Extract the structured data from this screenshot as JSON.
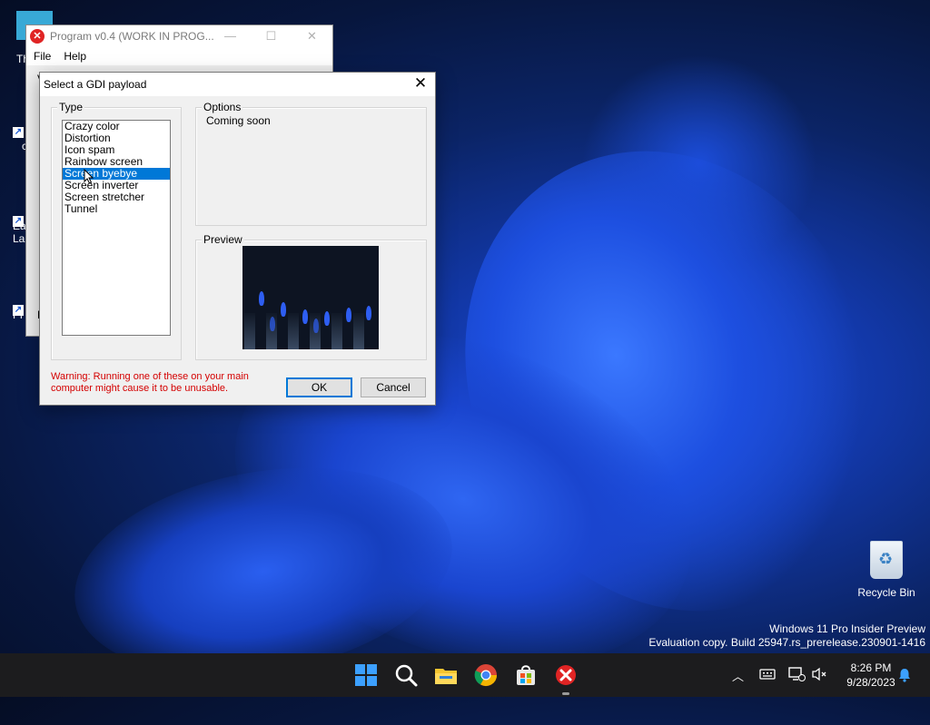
{
  "desktop": {
    "partial_labels": [
      "Th",
      "c",
      "Ea",
      "La",
      "Pr"
    ],
    "recycle_bin_label": "Recycle Bin",
    "watermark": {
      "line1": "Windows 11 Pro Insider Preview",
      "line2": "Evaluation copy. Build 25947.rs_prerelease.230901-1416"
    }
  },
  "background_window": {
    "title": "Program v0.4 (WORK IN PROG...",
    "menu": [
      "File",
      "Help"
    ],
    "peek_letters": [
      "V",
      "E"
    ]
  },
  "dialog": {
    "title": "Select a GDI payload",
    "type_group_label": "Type",
    "type_items": [
      "Crazy color",
      "Distortion",
      "Icon spam",
      "Rainbow screen",
      "Screen byebye",
      "Screen inverter",
      "Screen stretcher",
      "Tunnel"
    ],
    "selected_index": 4,
    "options_group_label": "Options",
    "options_text": "Coming soon",
    "preview_group_label": "Preview",
    "warning_line1": "Warning: Running one of these on your main",
    "warning_line2": "computer might cause it to be unusable.",
    "ok_label": "OK",
    "cancel_label": "Cancel"
  },
  "taskbar": {
    "apps": [
      "start-icon",
      "search-icon",
      "file-explorer-icon",
      "chrome-icon",
      "store-icon",
      "program-error-icon"
    ],
    "clock_time": "8:26 PM",
    "clock_date": "9/28/2023"
  },
  "colors": {
    "selection": "#0078d7",
    "warning": "#d40000",
    "taskbar": "#1c1c1e"
  }
}
